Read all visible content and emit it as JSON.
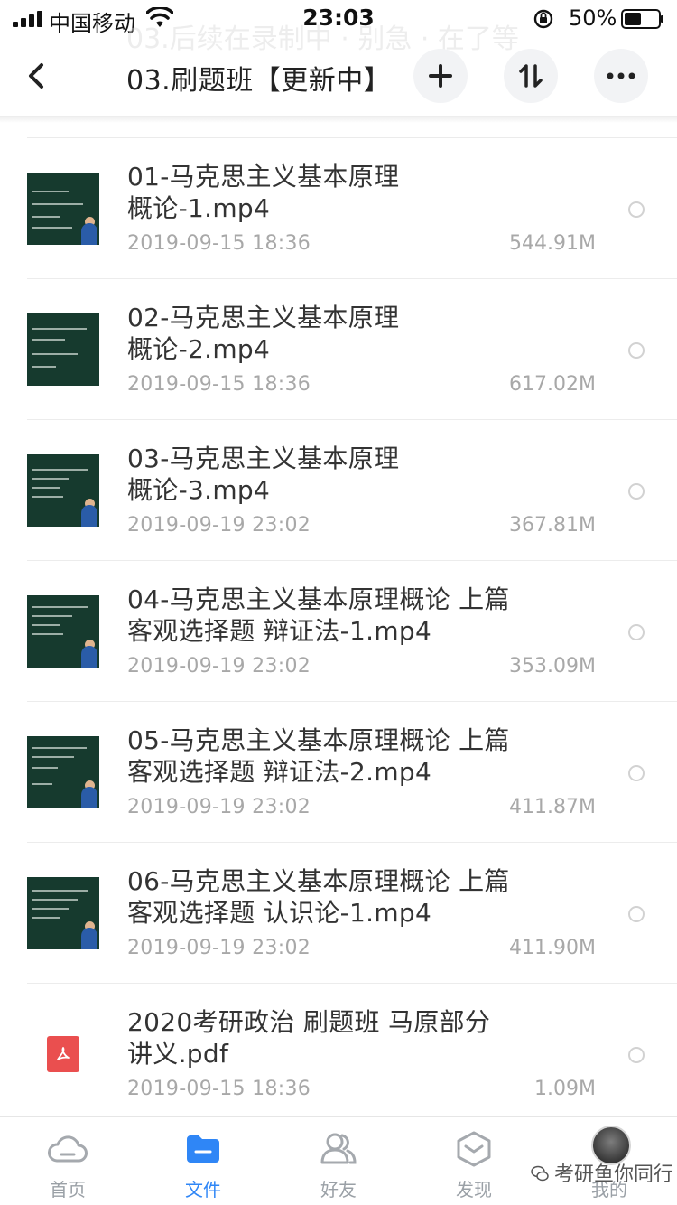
{
  "status_bar": {
    "carrier": "中国移动",
    "time": "23:03",
    "battery": "50%"
  },
  "ghost_text": "03.后续在录制中 · 别急 · 在了等",
  "nav": {
    "title": "03.刷题班【更新中】"
  },
  "files": [
    {
      "name": "01-马克思主义基本原理概论-1.mp4",
      "line1": "01-马克思主义基本原理",
      "line2": "概论-1.mp4",
      "date": "2019-09-15 18:36",
      "size": "544.91M",
      "type": "video"
    },
    {
      "name": "02-马克思主义基本原理概论-2.mp4",
      "line1": "02-马克思主义基本原理",
      "line2": "概论-2.mp4",
      "date": "2019-09-15 18:36",
      "size": "617.02M",
      "type": "video"
    },
    {
      "name": "03-马克思主义基本原理概论-3.mp4",
      "line1": "03-马克思主义基本原理",
      "line2": "概论-3.mp4",
      "date": "2019-09-19 23:02",
      "size": "367.81M",
      "type": "video"
    },
    {
      "name": "04-马克思主义基本原理概论 上篇 客观选择题 辩证法-1.mp4",
      "line1": "04-马克思主义基本原理概论 上篇",
      "line2": "客观选择题 辩证法-1.mp4",
      "date": "2019-09-19 23:02",
      "size": "353.09M",
      "type": "video"
    },
    {
      "name": "05-马克思主义基本原理概论 上篇 客观选择题 辩证法-2.mp4",
      "line1": "05-马克思主义基本原理概论 上篇",
      "line2": "客观选择题 辩证法-2.mp4",
      "date": "2019-09-19 23:02",
      "size": "411.87M",
      "type": "video"
    },
    {
      "name": "06-马克思主义基本原理概论 上篇 客观选择题 认识论-1.mp4",
      "line1": "06-马克思主义基本原理概论 上篇",
      "line2": "客观选择题 认识论-1.mp4",
      "date": "2019-09-19 23:02",
      "size": "411.90M",
      "type": "video"
    },
    {
      "name": "2020考研政治 刷题班 马原部分讲义.pdf",
      "line1": "2020考研政治 刷题班 马原部分",
      "line2": "讲义.pdf",
      "date": "2019-09-15 18:36",
      "size": "1.09M",
      "type": "pdf"
    }
  ],
  "tabs": [
    {
      "label": "首页",
      "icon": "cloud-icon",
      "active": false
    },
    {
      "label": "文件",
      "icon": "folder-icon",
      "active": true
    },
    {
      "label": "好友",
      "icon": "friends-icon",
      "active": false
    },
    {
      "label": "发现",
      "icon": "discover-icon",
      "active": false
    },
    {
      "label": "我的",
      "icon": "avatar",
      "active": false
    }
  ],
  "watermark": "考研鱼你同行",
  "colors": {
    "accent": "#2f86f6",
    "pdf": "#ea4f4f",
    "thumb_bg": "#163a2e"
  }
}
